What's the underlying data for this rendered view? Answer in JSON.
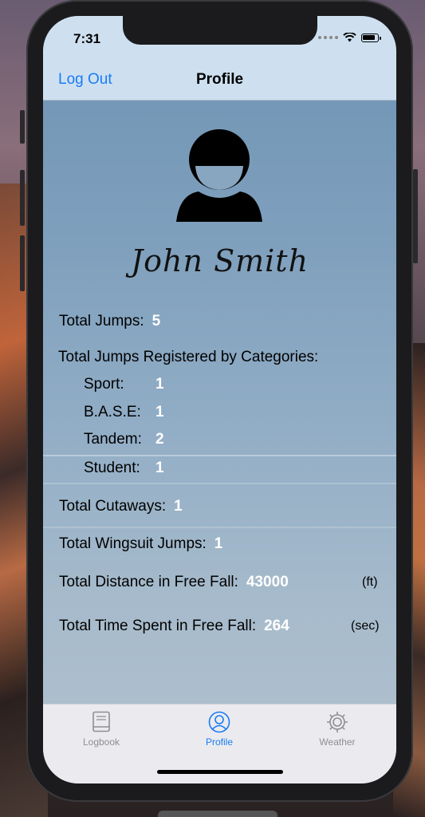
{
  "status_bar": {
    "time": "7:31"
  },
  "nav": {
    "left_button": "Log Out",
    "title": "Profile"
  },
  "profile": {
    "name": "John Smith"
  },
  "stats": {
    "total_jumps": {
      "label": "Total Jumps:",
      "value": "5"
    },
    "categories_header": "Total Jumps Registered by Categories:",
    "categories": [
      {
        "label": "Sport:",
        "value": "1"
      },
      {
        "label": "B.A.S.E:",
        "value": "1"
      },
      {
        "label": "Tandem:",
        "value": "2"
      },
      {
        "label": "Student:",
        "value": "1"
      }
    ],
    "cutaways": {
      "label": "Total Cutaways:",
      "value": "1"
    },
    "wingsuit": {
      "label": "Total Wingsuit Jumps:",
      "value": "1"
    },
    "distance": {
      "label": "Total Distance in Free Fall:",
      "value": "43000",
      "unit": "(ft)"
    },
    "time": {
      "label": "Total Time Spent in Free Fall:",
      "value": "264",
      "unit": "(sec)"
    }
  },
  "tabs": [
    {
      "label": "Logbook",
      "icon": "book-icon",
      "active": false
    },
    {
      "label": "Profile",
      "icon": "profile-icon",
      "active": true
    },
    {
      "label": "Weather",
      "icon": "gear-icon",
      "active": false
    }
  ],
  "colors": {
    "accent": "#1a7bf5",
    "inactive": "#8e8e93",
    "value_text": "#ffffff"
  }
}
